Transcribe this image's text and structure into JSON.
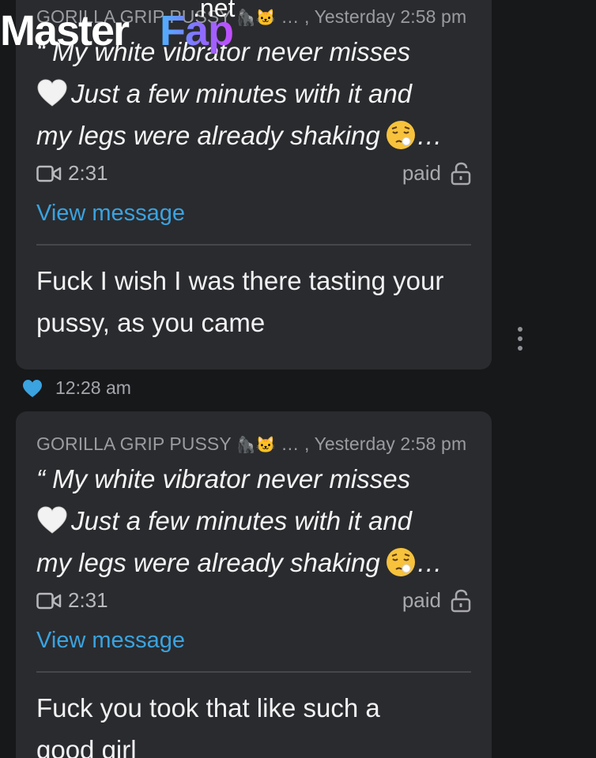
{
  "watermark": {
    "brand_white": "Master",
    "brand_gradient": "Fap",
    "brand_suffix": ".net"
  },
  "messages": [
    {
      "quote": {
        "sender": "GORILLA GRIP PUSSY",
        "sender_emojis": "🦍🐱",
        "separator": " … , ",
        "timestamp": "Yesterday 2:58 pm",
        "lines": [
          "“ My white vibrator never misses",
          "Just a few minutes with it and",
          "my legs were already shaking"
        ],
        "ellipsis": "…",
        "video_duration": "2:31",
        "price_label": "paid",
        "view_label": "View message"
      },
      "reply_lines": [
        "Fuck I wish I was there tasting your",
        "pussy, as you came"
      ],
      "time": "12:28 am",
      "liked": true
    },
    {
      "quote": {
        "sender": "GORILLA GRIP PUSSY",
        "sender_emojis": "🦍🐱",
        "separator": " … , ",
        "timestamp": "Yesterday 2:58 pm",
        "lines": [
          "“ My white vibrator never misses",
          "Just a few minutes with it and",
          "my legs were already shaking"
        ],
        "ellipsis": "…",
        "video_duration": "2:31",
        "price_label": "paid",
        "view_label": "View message"
      },
      "reply_lines": [
        "Fuck you took that like such a",
        "good girl"
      ]
    }
  ],
  "colors": {
    "background": "#17181a",
    "bubble": "#2a2b2e",
    "link": "#3aa3e0",
    "heart": "#3aa3e0",
    "muted_text": "#9a9ca1"
  },
  "icons": {
    "more": "vertical-ellipsis-icon",
    "like": "heart-icon",
    "video": "video-camera-icon",
    "unlocked": "unlock-icon"
  }
}
